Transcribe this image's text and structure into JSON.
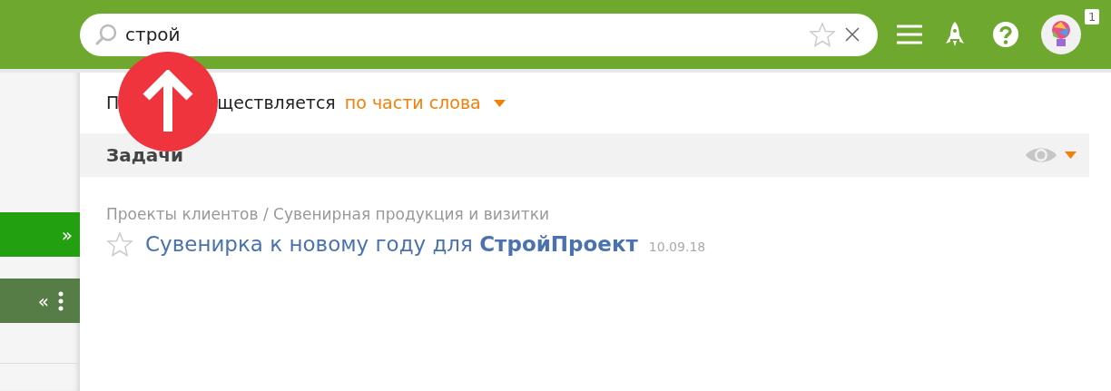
{
  "header": {
    "search": {
      "value": "строй"
    },
    "notification_count": "1"
  },
  "sidebar": {
    "buttons": [
      {
        "kind": "expand",
        "label": "»"
      },
      {
        "kind": "collapse",
        "label": "«"
      }
    ]
  },
  "dropdown": {
    "search_mode": {
      "label_visible_start": "П",
      "label_visible_end": "ществляется",
      "mode": "по части слова"
    },
    "sections": [
      {
        "title": "Задачи",
        "results": [
          {
            "path": "Проекты клиентов / Сувенирная продукция и визитки",
            "title": "Сувенирка к новому году для **СтройПроект**",
            "date": "10.09.18",
            "starred": false
          }
        ]
      }
    ]
  }
}
